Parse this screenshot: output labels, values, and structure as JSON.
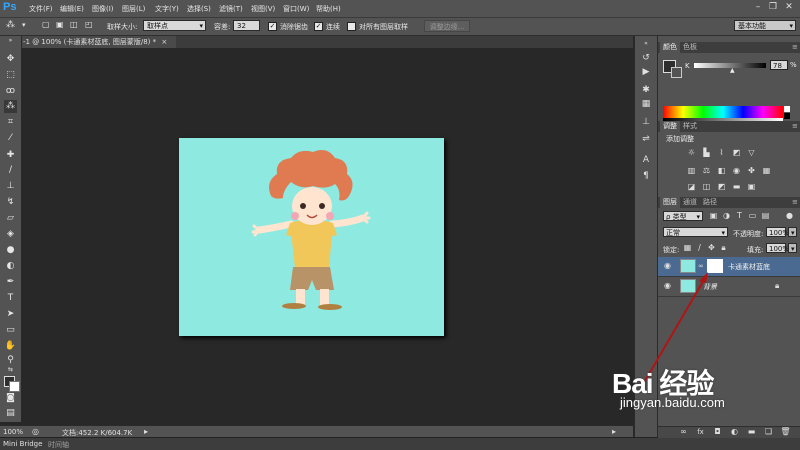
{
  "app": {
    "logo": "Ps"
  },
  "menubar": {
    "items": [
      "文件(F)",
      "编辑(E)",
      "图像(I)",
      "图层(L)",
      "文字(Y)",
      "选择(S)",
      "滤镜(T)",
      "视图(V)",
      "窗口(W)",
      "帮助(H)"
    ]
  },
  "options": {
    "sample_size_label": "取样大小:",
    "sample_size_value": "取样点",
    "tolerance_label": "容差:",
    "tolerance_value": "32",
    "anti_alias_label": "消除锯齿",
    "contiguous_label": "连续",
    "sample_all_layers_label": "对所有图层取样",
    "refine_edge_button": "调整边缘...",
    "workspace_value": "基本功能"
  },
  "document": {
    "tab_title": "-1 @ 100% (卡通素材蓝底, 图层蒙版/8) *",
    "tab_close": "×",
    "zoom": "100%",
    "doc_info": "文档:452.2 K/604.7K",
    "colors": {
      "canvas_bg": "#8ee9e0"
    }
  },
  "bottombar": {
    "tabs": [
      "Mini Bridge",
      "时间轴"
    ]
  },
  "color_panel": {
    "tabs": [
      "颜色",
      "色板"
    ],
    "channel_label": "K",
    "value": "78",
    "unit": "%"
  },
  "adjust_panel": {
    "tabs": [
      "调整",
      "样式"
    ],
    "title": "添加调整"
  },
  "layers_panel": {
    "tabs": [
      "图层",
      "通道",
      "路径"
    ],
    "filter_label": "ρ 类型",
    "blend_mode": "正常",
    "opacity_label": "不透明度:",
    "opacity_value": "100%",
    "lock_label": "锁定:",
    "fill_label": "填充:",
    "fill_value": "100%",
    "layers": [
      {
        "name": "卡通素材蓝底",
        "selected": true
      },
      {
        "name": "背景",
        "selected": false
      }
    ]
  },
  "watermark": {
    "brand": "Bai 经验",
    "url": "jingyan.baidu.com"
  },
  "icons": [
    "magic-wand-icon",
    "eye-icon",
    "lock-icon",
    "link-icon",
    "trash-icon",
    "folder-icon",
    "fx-icon",
    "mask-icon"
  ]
}
